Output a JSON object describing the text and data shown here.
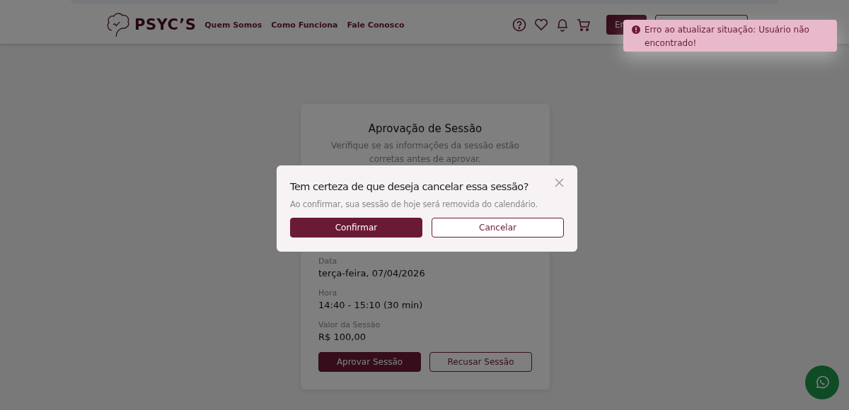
{
  "header": {
    "logo": "PSYC’S",
    "nav": [
      "Quem Somos",
      "Como Funciona",
      "Fale Conosco"
    ],
    "primary_button": "En"
  },
  "card": {
    "title": "Aprovação de Sessão",
    "subtitle": "Verifique se as informações da sessão estão corretas antes de aprovar.",
    "fields": [
      {
        "label": "Data",
        "value": "terça-feira, 07/04/2026"
      },
      {
        "label": "Hora",
        "value": "14:40 - 15:10 (30 min)"
      },
      {
        "label": "Valor da Sessão",
        "value": "R$ 100,00"
      }
    ],
    "buttons": [
      "Aprovar Sessão",
      "Recusar Sessão"
    ]
  },
  "modal": {
    "title": "Tem certeza de que deseja cancelar essa sessão?",
    "message": "Ao confirmar, sua sessão de hoje será removida do calendário.",
    "confirm": "Confirmar",
    "cancel": "Cancelar"
  },
  "toast": {
    "message": "Erro ao atualizar situação: Usuário não encontrado!"
  }
}
